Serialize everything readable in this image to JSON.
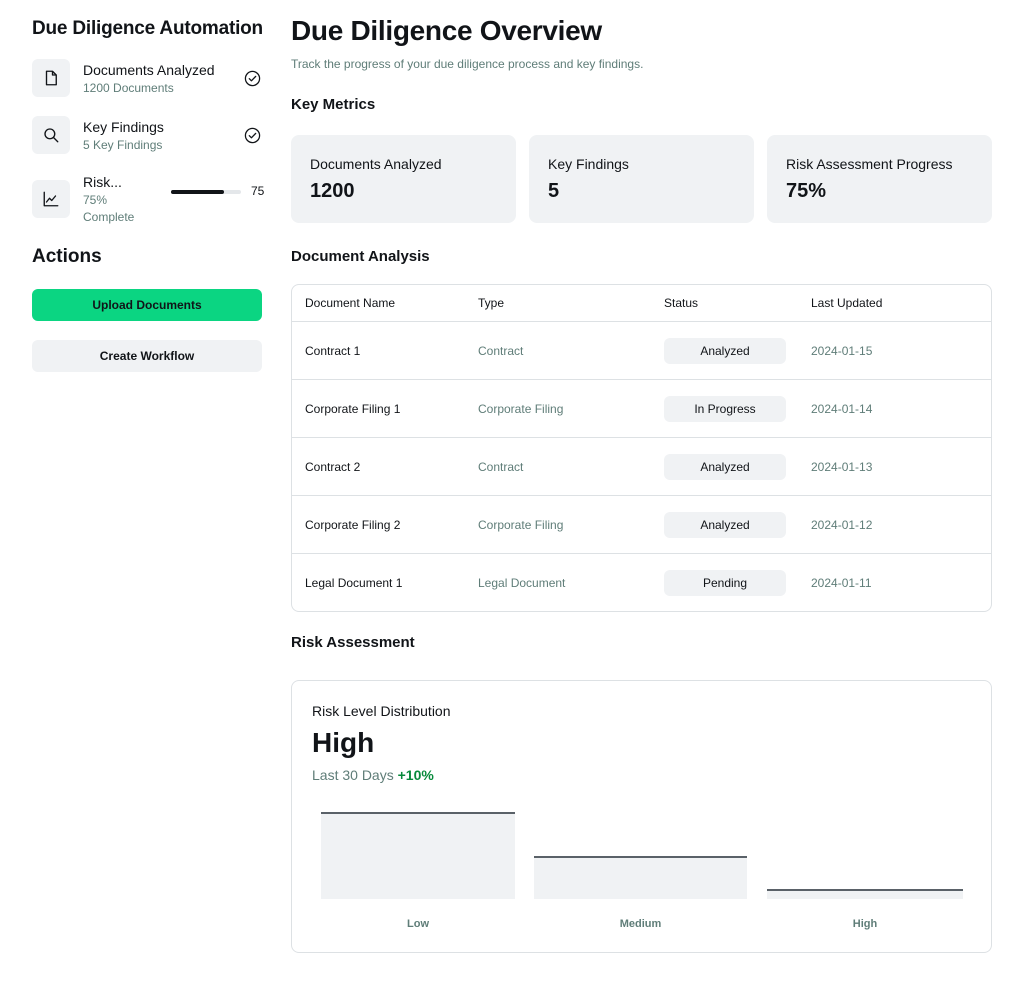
{
  "sidebar": {
    "app_title": "Due Diligence Automation",
    "items": [
      {
        "title": "Documents Analyzed",
        "subtitle": "1200 Documents",
        "icon": "document-icon",
        "status_icon": "check-circle-icon"
      },
      {
        "title": "Key Findings",
        "subtitle": "5 Key Findings",
        "icon": "search-icon",
        "status_icon": "check-circle-icon"
      },
      {
        "title": "Risk...",
        "subtitle_line1": "75%",
        "subtitle_line2": "Complete",
        "icon": "chart-line-icon",
        "progress": 75,
        "progress_label": "75"
      }
    ],
    "actions_title": "Actions",
    "upload_label": "Upload Documents",
    "workflow_label": "Create Workflow"
  },
  "main": {
    "title": "Due Diligence Overview",
    "subtitle": "Track the progress of your due diligence process and key findings.",
    "metrics_title": "Key Metrics",
    "metrics": [
      {
        "label": "Documents Analyzed",
        "value": "1200"
      },
      {
        "label": "Key Findings",
        "value": "5"
      },
      {
        "label": "Risk Assessment Progress",
        "value": "75%"
      }
    ],
    "analysis_title": "Document Analysis",
    "table": {
      "columns": [
        "Document Name",
        "Type",
        "Status",
        "Last Updated"
      ],
      "rows": [
        {
          "name": "Contract 1",
          "type": "Contract",
          "status": "Analyzed",
          "updated": "2024-01-15"
        },
        {
          "name": "Corporate Filing 1",
          "type": "Corporate Filing",
          "status": "In Progress",
          "updated": "2024-01-14"
        },
        {
          "name": "Contract 2",
          "type": "Contract",
          "status": "Analyzed",
          "updated": "2024-01-13"
        },
        {
          "name": "Corporate Filing 2",
          "type": "Corporate Filing",
          "status": "Analyzed",
          "updated": "2024-01-12"
        },
        {
          "name": "Legal Document 1",
          "type": "Legal Document",
          "status": "Pending",
          "updated": "2024-01-11"
        }
      ]
    },
    "risk_title": "Risk Assessment",
    "risk": {
      "label": "Risk Level Distribution",
      "value": "High",
      "period": "Last 30 Days",
      "change": "+10%"
    }
  },
  "chart_data": {
    "type": "bar",
    "categories": [
      "Low",
      "Medium",
      "High"
    ],
    "values": [
      100,
      50,
      12
    ],
    "ylim": [
      0,
      100
    ]
  },
  "colors": {
    "accent": "#0bd582",
    "muted_text": "#5f7d78",
    "surface": "#f0f2f4",
    "positive": "#078a3b"
  }
}
